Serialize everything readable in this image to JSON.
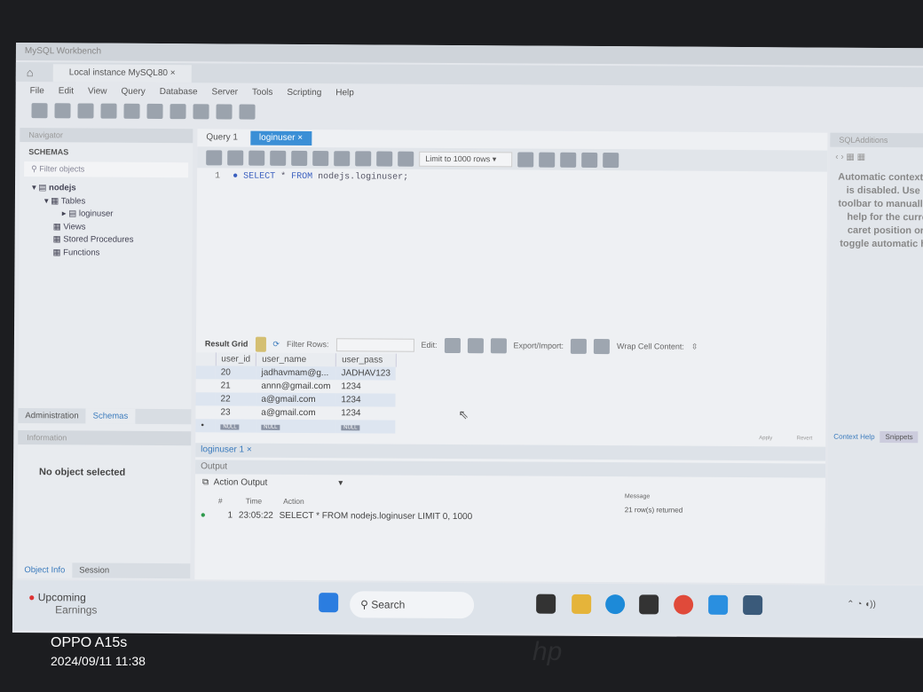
{
  "window": {
    "title": "MySQL Workbench",
    "connection_tab": "Local instance MySQL80"
  },
  "menu": [
    "File",
    "Edit",
    "View",
    "Query",
    "Database",
    "Server",
    "Tools",
    "Scripting",
    "Help"
  ],
  "navigator": {
    "header": "Navigator",
    "schemas_label": "SCHEMAS",
    "filter_placeholder": "Filter objects",
    "tree": {
      "schema": "nodejs",
      "tables": "Tables",
      "table": "loginuser",
      "views": "Views",
      "procs": "Stored Procedures",
      "funcs": "Functions"
    },
    "tabs": [
      "Administration",
      "Schemas"
    ],
    "info_header": "Information",
    "no_object": "No object selected",
    "bottom_tabs": [
      "Object Info",
      "Session"
    ]
  },
  "editor": {
    "tabs": [
      "Query 1",
      "loginuser"
    ],
    "limit": "Limit to 1000 rows",
    "line": "1",
    "sql_kw1": "SELECT",
    "sql_rest1": " * ",
    "sql_kw2": "FROM",
    "sql_rest2": " nodejs.loginuser;"
  },
  "result": {
    "toolbar": {
      "grid": "Result Grid",
      "filter": "Filter Rows:",
      "edit": "Edit:",
      "export": "Export/Import:",
      "wrap": "Wrap Cell Content:"
    },
    "columns": [
      "user_id",
      "user_name",
      "user_pass"
    ],
    "rows": [
      [
        "20",
        "jadhavmam@g...",
        "JADHAV123"
      ],
      [
        "21",
        "annn@gmail.com",
        "1234"
      ],
      [
        "22",
        "a@gmail.com",
        "1234"
      ],
      [
        "23",
        "a@gmail.com",
        "1234"
      ]
    ],
    "null": "NULL",
    "tab": "loginuser 1",
    "apply": "Apply",
    "revert": "Revert"
  },
  "output": {
    "header": "Output",
    "selector": "Action Output",
    "columns": {
      "num": "#",
      "time": "Time",
      "action": "Action",
      "message": "Message"
    },
    "row": {
      "num": "1",
      "time": "23:05:22",
      "action": "SELECT * FROM nodejs.loginuser LIMIT 0, 1000",
      "message": "21 row(s) returned"
    }
  },
  "sql_additions": {
    "header": "SQLAdditions",
    "text": "Automatic context help is disabled. Use the toolbar to manually get help for the current caret position or to toggle automatic help.",
    "tabs": [
      "Context Help",
      "Snippets"
    ]
  },
  "taskbar": {
    "widget_title": "Upcoming",
    "widget_sub": "Earnings",
    "search": "Search"
  },
  "camera": {
    "model": "OPPO A15s",
    "datetime": "2024/09/11 11:38"
  }
}
